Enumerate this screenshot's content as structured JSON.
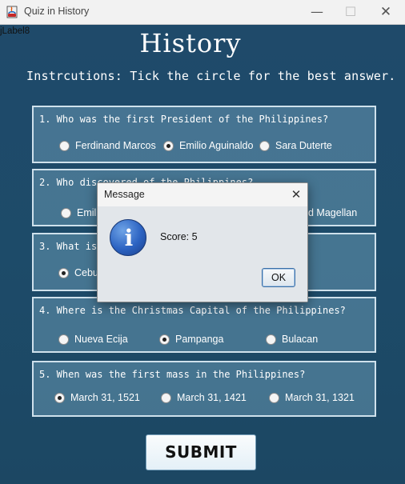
{
  "window": {
    "title": "Quiz in History",
    "controls": {
      "minimize": "—",
      "maximize": "☐",
      "close": "✕"
    }
  },
  "debug_label": "jLabel8",
  "heading": "History",
  "instructions": "Instrcutions: Tick the circle for the best answer.",
  "questions": [
    {
      "text": "1. Who was the first President of the Philippines?",
      "options": [
        {
          "label": "Ferdinand Marcos",
          "selected": false
        },
        {
          "label": "Emilio Aguinaldo",
          "selected": true
        },
        {
          "label": "Sara Duterte",
          "selected": false
        }
      ]
    },
    {
      "text": "2. Who discovered of the Philippines?",
      "options": [
        {
          "label": "Emili",
          "selected": false
        },
        {
          "label": "d Magellan",
          "selected": false
        }
      ]
    },
    {
      "text": "3. What is",
      "options": [
        {
          "label": "Cebu",
          "selected": true
        }
      ]
    },
    {
      "text": "4. Where is the Christmas Capital of the Philippines?",
      "options": [
        {
          "label": "Nueva Ecija",
          "selected": false
        },
        {
          "label": "Pampanga",
          "selected": true
        },
        {
          "label": "Bulacan",
          "selected": false
        }
      ]
    },
    {
      "text": "5. When was the first mass in the Philippines?",
      "options": [
        {
          "label": "March 31, 1521",
          "selected": true
        },
        {
          "label": "March 31, 1421",
          "selected": false
        },
        {
          "label": "March 31, 1321",
          "selected": false
        }
      ]
    }
  ],
  "submit_label": "SUBMIT",
  "dialog": {
    "title": "Message",
    "close": "✕",
    "icon": "information-icon",
    "icon_glyph": "i",
    "message": "Score: 5",
    "ok_label": "OK"
  },
  "colors": {
    "background": "#1d4a68",
    "panel_border": "#cfe1ec",
    "info_icon": "#2c63c2"
  }
}
